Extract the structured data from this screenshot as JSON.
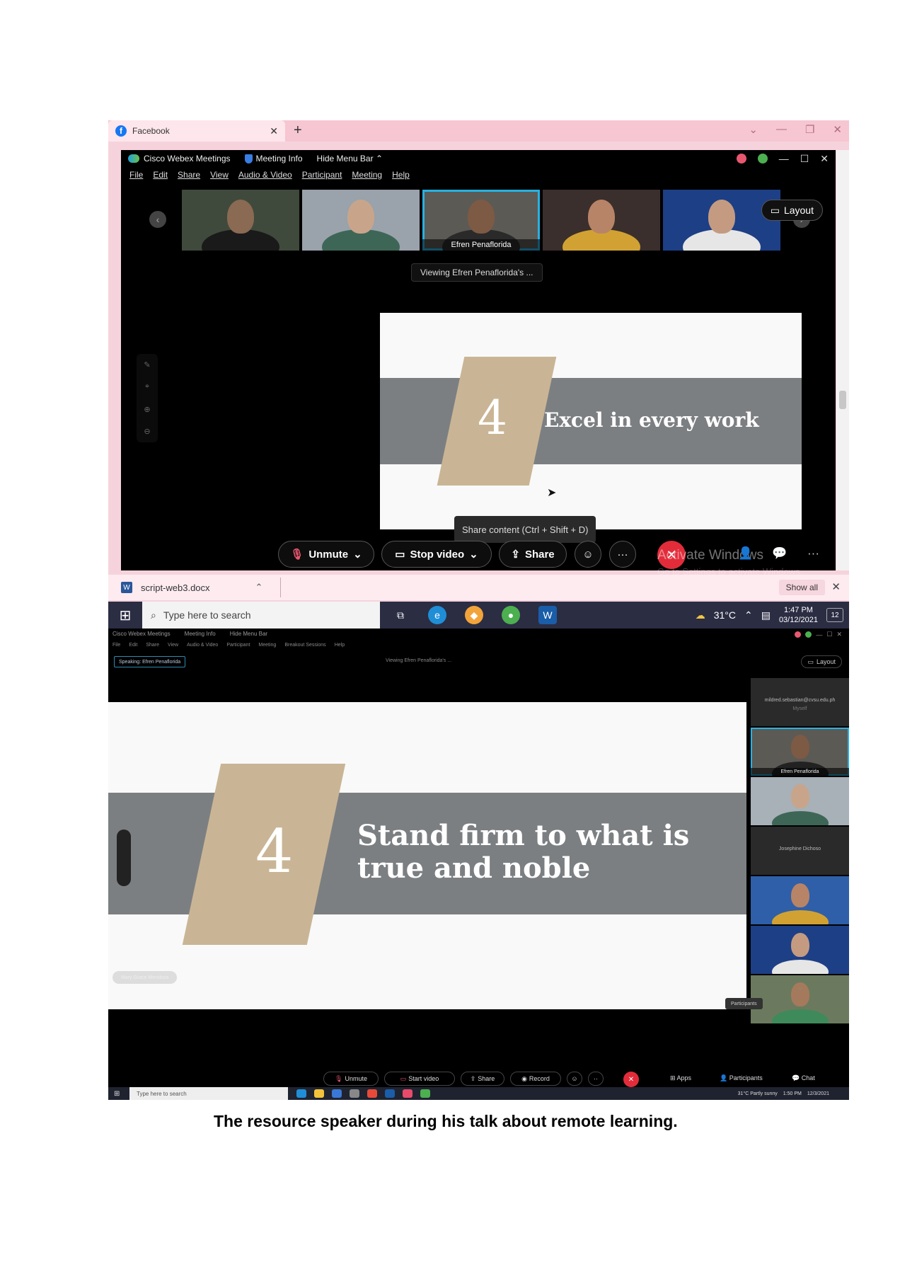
{
  "top_screenshot": {
    "browser": {
      "tab_title": "Facebook",
      "tab_close": "✕",
      "new_tab": "+",
      "icon": "facebook-icon"
    },
    "webex": {
      "app_title": "Cisco Webex Meetings",
      "meeting_info": "Meeting Info",
      "hide_menu_bar": "Hide Menu Bar",
      "menu": [
        "File",
        "Edit",
        "Share",
        "View",
        "Audio & Video",
        "Participant",
        "Meeting",
        "Help"
      ],
      "participants": [
        {
          "name": ""
        },
        {
          "name": ""
        },
        {
          "name": "Efren Penaflorida"
        },
        {
          "name": ""
        },
        {
          "name": ""
        }
      ],
      "layout_label": "Layout",
      "viewing": "Viewing Efren Penaflorida's ...",
      "slide": {
        "number": "4",
        "title": "Excel in every work"
      },
      "tooltip": "Share content (Ctrl + Shift + D)",
      "controls": {
        "unmute": "Unmute",
        "stop_video": "Stop video",
        "share": "Share",
        "more": "···",
        "end": "✕"
      },
      "watermark": "Activate Windows",
      "watermark_sub": "Go to Settings to activate Windows."
    },
    "downloads": {
      "file": "script-web3.docx",
      "show_all": "Show all",
      "close": "✕"
    },
    "taskbar": {
      "search_placeholder": "Type here to search",
      "temperature": "31°C",
      "time": "1:47 PM",
      "date": "03/12/2021",
      "notifications": "12"
    }
  },
  "bottom_screenshot": {
    "webex": {
      "app_title": "Cisco Webex Meetings",
      "meeting_info": "Meeting Info",
      "hide_menu_bar": "Hide Menu Bar",
      "menu": [
        "File",
        "Edit",
        "Share",
        "View",
        "Audio & Video",
        "Participant",
        "Meeting",
        "Breakout Sessions",
        "Help"
      ],
      "speaking": "Speaking: Efren Penaflorida",
      "viewing": "Viewing Efren Penaflorida's ...",
      "layout_label": "Layout",
      "slide": {
        "number": "4",
        "title_line1": "Stand firm to what is",
        "title_line2": "true and noble",
        "presenter_tag": "Mary Grace Mendoza"
      },
      "panel": [
        {
          "name": "mildred.sebastian@cvsu.edu.ph",
          "sub": "Myself"
        },
        {
          "name": "Efren Penaflorida"
        },
        {
          "name": ""
        },
        {
          "name": "Josephine Dichoso"
        },
        {
          "name": ""
        },
        {
          "name": ""
        },
        {
          "name": ""
        }
      ],
      "participants_tip": "Participants",
      "controls": {
        "unmute": "Unmute",
        "start_video": "Start video",
        "share": "Share",
        "record": "Record",
        "apps": "Apps",
        "participants": "Participants",
        "chat": "Chat"
      }
    },
    "taskbar": {
      "search_placeholder": "Type here to search",
      "weather": "31°C  Partly sunny",
      "time": "1:50 PM",
      "date": "12/3/2021"
    }
  },
  "caption": "The resource speaker during his talk about remote learning.",
  "colors": {
    "webex_blue": "#27b2e3",
    "end_red": "#e22c3a",
    "slide_band": "#7c7f82",
    "slide_parallelogram": "#c9b595",
    "browser_pink": "#f6c6d2"
  }
}
